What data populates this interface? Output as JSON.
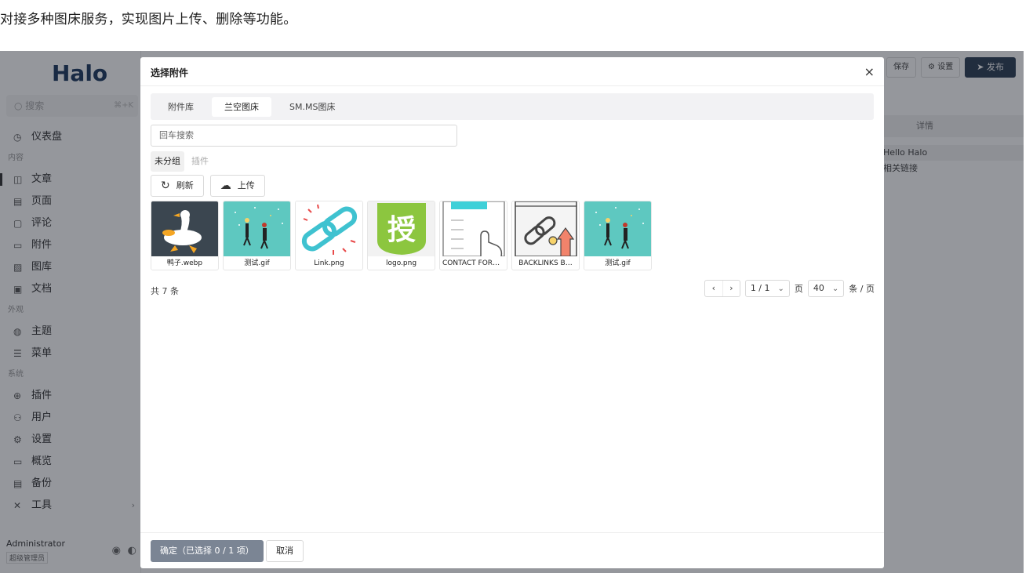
{
  "caption": "对接多种图床服务，实现图片上传、删除等功能。",
  "sidebar": {
    "logo": "Halo",
    "search_placeholder": "搜索",
    "search_shortcut": "⌘+K",
    "groups": {
      "dashboard": "仪表盘",
      "content": "内容",
      "appearance": "外观",
      "system": "系统"
    },
    "items": {
      "posts": "文章",
      "pages": "页面",
      "comments": "评论",
      "attachments": "附件",
      "gallery": "图库",
      "docs": "文档",
      "themes": "主题",
      "menus": "菜单",
      "plugins": "插件",
      "users": "用户",
      "settings": "设置",
      "overview": "概览",
      "backups": "备份",
      "tools": "工具"
    },
    "user": {
      "name": "Administrator",
      "role": "超级管理员"
    }
  },
  "background": {
    "buttons": {
      "save": "保存",
      "settings": "设置",
      "publish": "发布"
    },
    "tab_detail": "详情",
    "list": [
      "Hello Halo",
      "相关链接"
    ]
  },
  "modal": {
    "title": "选择附件",
    "tabs": [
      "附件库",
      "兰空图床",
      "SM.MS图床"
    ],
    "active_tab": 1,
    "search_placeholder": "回车搜索",
    "groups": [
      "未分组",
      "插件"
    ],
    "refresh_label": "刷新",
    "upload_label": "上传",
    "items": [
      {
        "name": "鸭子.webp",
        "thumb": "duck"
      },
      {
        "name": "测试.gif",
        "thumb": "festive"
      },
      {
        "name": "Link.png",
        "thumb": "chain"
      },
      {
        "name": "logo.png",
        "thumb": "logo",
        "glyph": "授"
      },
      {
        "name": "CONTACT FORM…",
        "thumb": "contact"
      },
      {
        "name": "BACKLINKS B…",
        "thumb": "backlinks"
      },
      {
        "name": "测试.gif",
        "thumb": "festive"
      }
    ],
    "total_label": "共 7 条",
    "pagination": {
      "page": "1 / 1",
      "page_unit": "页",
      "page_size": "40",
      "size_unit": "条 / 页"
    },
    "ok_label": "确定（已选择 0 / 1 项）",
    "cancel_label": "取消"
  },
  "colors": {
    "overlay": "#141923",
    "thumb_teal": "#5ec8c0",
    "thumb_dark": "#3b4650",
    "logo_green": "#8cc63f",
    "backlinks_orange": "#f2836b"
  }
}
